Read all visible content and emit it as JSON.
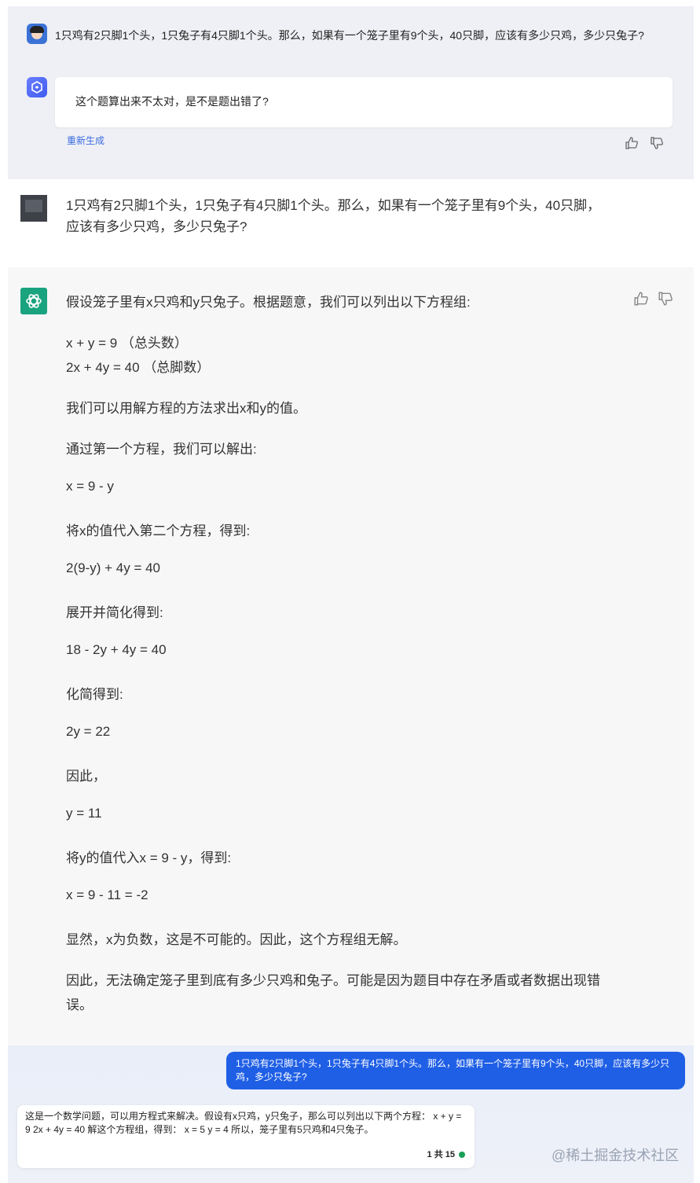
{
  "top": {
    "question": "1只鸡有2只脚1个头，1只兔子有4只脚1个头。那么，如果有一个笼子里有9个头，40只脚，应该有多少只鸡，多少只兔子?",
    "reply": "这个题算出来不太对，是不是题出错了?",
    "regenerate": "重新生成"
  },
  "user_prompt": {
    "line1": "1只鸡有2只脚1个头，1只兔子有4只脚1个头。那么，如果有一个笼子里有9个头，40只脚，",
    "line2": "应该有多少只鸡，多少只兔子?"
  },
  "answer": {
    "lines": [
      "假设笼子里有x只鸡和y只兔子。根据题意，我们可以列出以下方程组:",
      "x + y = 9 （总头数）",
      "2x + 4y = 40 （总脚数）",
      "我们可以用解方程的方法求出x和y的值。",
      "通过第一个方程，我们可以解出:",
      "x = 9 - y",
      "将x的值代入第二个方程，得到:",
      "2(9-y) + 4y = 40",
      "展开并简化得到:",
      "18 - 2y + 4y = 40",
      "化简得到:",
      "2y = 22",
      "因此，",
      "y = 11",
      "将y的值代入x = 9 - y，得到:",
      "x = 9 - 11 = -2",
      "显然，x为负数，这是不可能的。因此，这个方程组无解。",
      "因此，无法确定笼子里到底有多少只鸡和兔子。可能是因为题目中存在矛盾或者数据出现错",
      "误。"
    ]
  },
  "bottom": {
    "user_message": "1只鸡有2只脚1个头，1只兔子有4只脚1个头。那么，如果有一个笼子里有9个头，40只脚，应该有多少只鸡，多少只兔子?",
    "bot_reply": "这是一个数学问题，可以用方程式来解决。假设有x只鸡，y只兔子，那么可以列出以下两个方程： x + y = 9 2x + 4y = 40 解这个方程组，得到： x = 5 y = 4 所以，笼子里有5只鸡和4只兔子。",
    "page_info": "1 共 15",
    "status_color": "#1a9e5a"
  },
  "watermark": "@稀土掘金技术社区"
}
